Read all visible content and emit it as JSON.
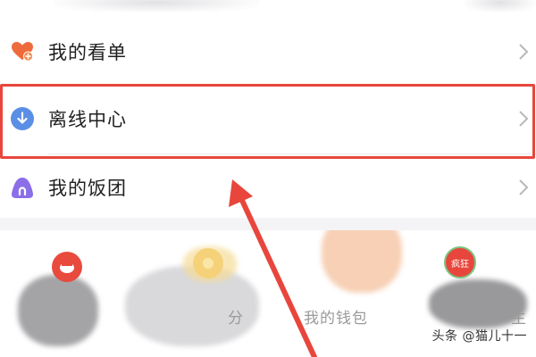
{
  "menu": {
    "items": [
      {
        "label": "我的看单",
        "icon": "heart-plus-icon",
        "icon_color": "#ee6b3b"
      },
      {
        "label": "离线中心",
        "icon": "download-icon",
        "icon_color": "#5b8fe6"
      },
      {
        "label": "我的饭团",
        "icon": "rice-ball-icon",
        "icon_color": "#8b6ee8"
      }
    ]
  },
  "highlight_color": "#e8463c",
  "shortcuts": {
    "items": [
      {
        "label": "",
        "icon": "red-round-icon"
      },
      {
        "label": "分",
        "icon": "yellow-round-icon"
      },
      {
        "label": "我的钱包",
        "icon": "orange-round-icon"
      },
      {
        "label": "主",
        "icon": "crazy-badge-icon",
        "badge_text": "疯狂"
      }
    ]
  },
  "watermark": "头条 @猫儿十一"
}
